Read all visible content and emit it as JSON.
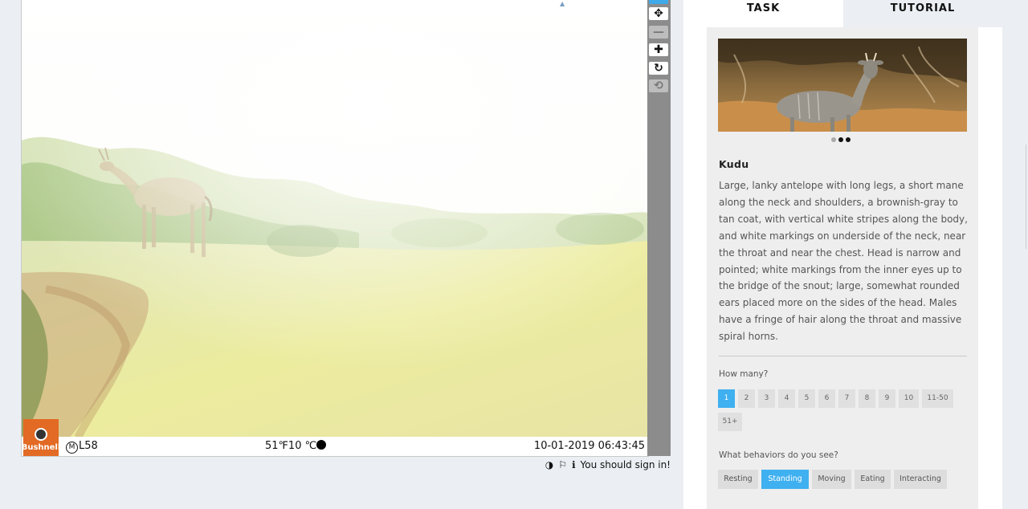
{
  "camera": {
    "brand": "Bushnell",
    "model": "L58",
    "model_prefix": "M",
    "temp_f": "51℉",
    "temp_c": "10 ℃",
    "datetime": "10-01-2019 06:43:45"
  },
  "toolbar": {
    "tools": [
      {
        "name": "pointer-tool",
        "icon": "pointer-icon",
        "glyph": "",
        "state": "active"
      },
      {
        "name": "pan-tool",
        "icon": "move-icon",
        "glyph": "✥",
        "state": "normal"
      },
      {
        "name": "zoom-out-tool",
        "icon": "minus-icon",
        "glyph": "—",
        "state": "dim"
      },
      {
        "name": "zoom-in-tool",
        "icon": "plus-icon",
        "glyph": "✚",
        "state": "normal"
      },
      {
        "name": "rotate-tool",
        "icon": "rotate-icon",
        "glyph": "↻",
        "state": "normal"
      },
      {
        "name": "reset-tool",
        "icon": "reset-icon",
        "glyph": "⟲",
        "state": "dim"
      }
    ]
  },
  "footer": {
    "sign_in_text": "You should sign in!",
    "invert_glyph": "◑",
    "flag_glyph": "⚐",
    "info_glyph": "ℹ"
  },
  "tabs": {
    "task": "TASK",
    "tutorial": "TUTORIAL"
  },
  "species": {
    "name": "Kudu",
    "description": "Large, lanky antelope with long legs, a short mane along the neck and shoulders, a brownish-gray to tan coat, with vertical white stripes along the body, and white markings on underside of the neck, near the throat and near the chest. Head is narrow and pointed; white markings from the inner eyes up to the bridge of the snout; large, somewhat rounded ears placed more on the sides of the head. Males have a fringe of hair along the throat and massive spiral horns.",
    "carousel_index": 1,
    "carousel_count": 3
  },
  "questions": {
    "how_many": {
      "label": "How many?",
      "options": [
        "1",
        "2",
        "3",
        "4",
        "5",
        "6",
        "7",
        "8",
        "9",
        "10",
        "11-50",
        "51+"
      ],
      "selected": "1"
    },
    "behaviors": {
      "label": "What behaviors do you see?",
      "options": [
        "Resting",
        "Standing",
        "Moving",
        "Eating",
        "Interacting"
      ],
      "selected": [
        "Standing"
      ]
    }
  },
  "colors": {
    "accent": "#3fb0f0",
    "brand_badge": "#e26a24",
    "toolbar": "#8c8c8c"
  }
}
